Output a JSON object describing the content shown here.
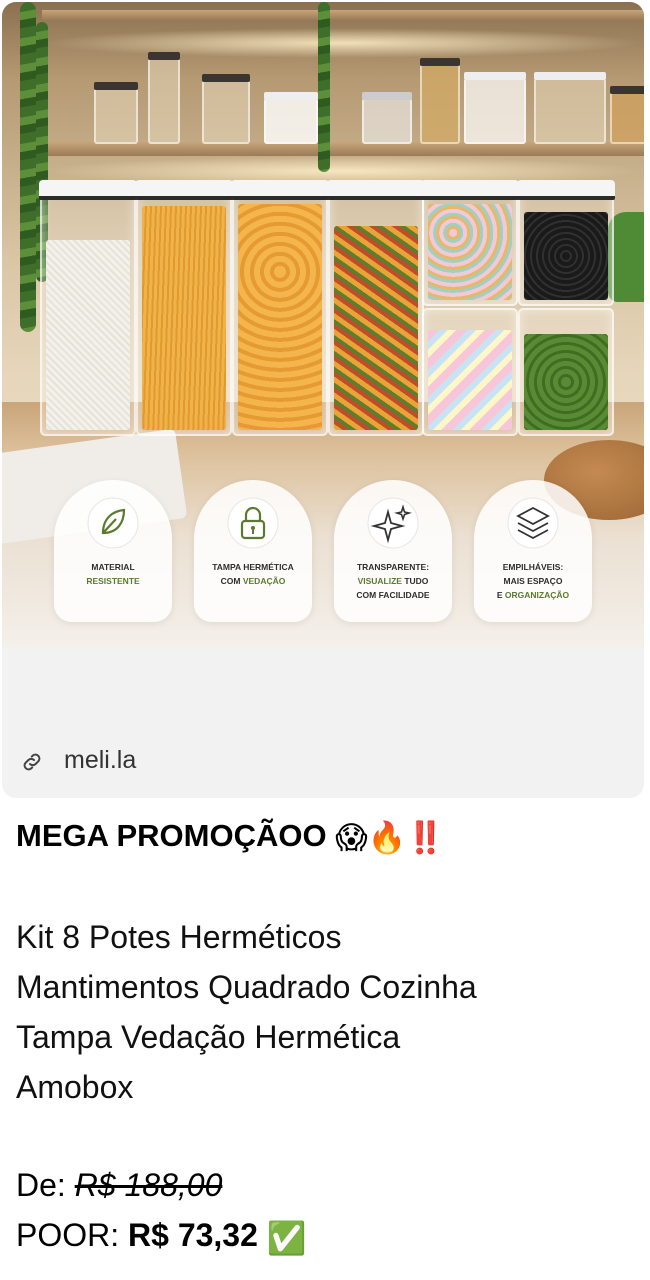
{
  "link": {
    "domain": "meli.la",
    "icon": "link-icon"
  },
  "features": [
    {
      "icon": "leaf-icon",
      "line1": "MATERIAL",
      "line2_green": "RESISTENTE",
      "line3": ""
    },
    {
      "icon": "padlock-icon",
      "line1": "TAMPA HERMÉTICA",
      "line2_prefix": "COM ",
      "line2_green": "VEDAÇÃO",
      "line3": ""
    },
    {
      "icon": "sparkle-icon",
      "line1": "TRANSPARENTE:",
      "line2_green": "VISUALIZE",
      "line2_suffix": " TUDO",
      "line3": "COM FACILIDADE"
    },
    {
      "icon": "stack-layers-icon",
      "line1": "EMPILHÁVEIS:",
      "line2": "MAIS ESPAÇO",
      "line3_prefix": "E ",
      "line3_green": "ORGANIZAÇÃO"
    }
  ],
  "message": {
    "title": "MEGA PROMOÇÃOO",
    "title_emojis": [
      "😱",
      "🔥",
      "‼️"
    ],
    "description_lines": [
      "Kit 8 Potes Herméticos",
      "Mantimentos Quadrado Cozinha",
      "Tampa Vedação Hermética",
      "Amobox"
    ],
    "old_price_label": "De:",
    "old_price": "R$ 188,00",
    "new_price_label": "POOR:",
    "new_price": "R$ 73,32",
    "new_price_emoji": "✅"
  },
  "colors": {
    "accent_green": "#5a7a2c",
    "card_bg": "#f2f2f3"
  }
}
